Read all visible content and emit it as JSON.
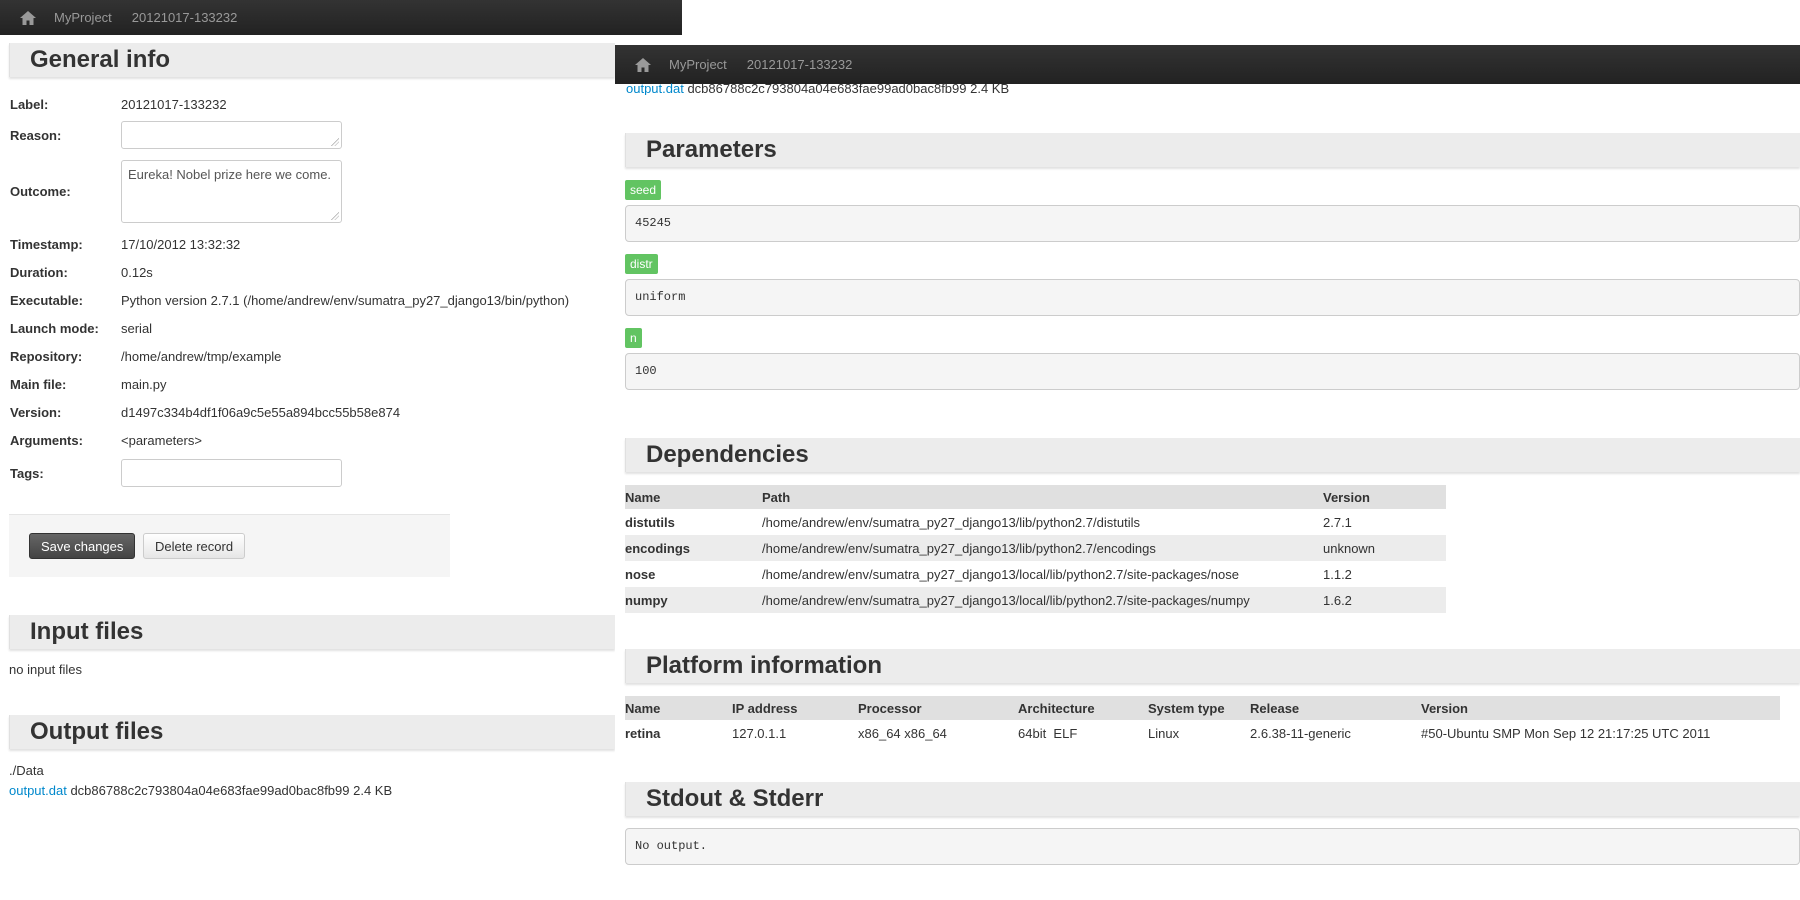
{
  "navbar": {
    "project": "MyProject",
    "record": "20121017-133232"
  },
  "general": {
    "title": "General info",
    "fields": {
      "label_key": "Label:",
      "label_val": "20121017-133232",
      "reason_key": "Reason:",
      "reason_val": "",
      "outcome_key": "Outcome:",
      "outcome_val": "Eureka! Nobel prize here we come.",
      "timestamp_key": "Timestamp:",
      "timestamp_val": "17/10/2012 13:32:32",
      "duration_key": "Duration:",
      "duration_val": "0.12s",
      "executable_key": "Executable:",
      "executable_val": "Python version 2.7.1 (/home/andrew/env/sumatra_py27_django13/bin/python)",
      "launch_key": "Launch mode:",
      "launch_val": "serial",
      "repo_key": "Repository:",
      "repo_val": "/home/andrew/tmp/example",
      "main_key": "Main file:",
      "main_val": "main.py",
      "version_key": "Version:",
      "version_val": "d1497c334b4df1f06a9c5e55a894bcc55b58e874",
      "args_key": "Arguments:",
      "args_val": "<parameters>",
      "tags_key": "Tags:",
      "tags_val": ""
    },
    "save_label": "Save changes",
    "delete_label": "Delete record"
  },
  "input_files": {
    "title": "Input files",
    "empty_text": "no input files"
  },
  "output_files": {
    "title": "Output files",
    "dir": "./Data",
    "file_name": "output.dat",
    "file_hash": "dcb86788c2c793804a04e683fae99ad0bac8fb99",
    "file_size": "2.4 KB"
  },
  "parameters": {
    "title": "Parameters",
    "items": [
      {
        "name": "seed",
        "value": "45245"
      },
      {
        "name": "distr",
        "value": "uniform"
      },
      {
        "name": "n",
        "value": "100"
      }
    ]
  },
  "dependencies": {
    "title": "Dependencies",
    "headers": [
      "Name",
      "Path",
      "Version"
    ],
    "rows": [
      [
        "distutils",
        "/home/andrew/env/sumatra_py27_django13/lib/python2.7/distutils",
        "2.7.1"
      ],
      [
        "encodings",
        "/home/andrew/env/sumatra_py27_django13/lib/python2.7/encodings",
        "unknown"
      ],
      [
        "nose",
        "/home/andrew/env/sumatra_py27_django13/local/lib/python2.7/site-packages/nose",
        "1.1.2"
      ],
      [
        "numpy",
        "/home/andrew/env/sumatra_py27_django13/local/lib/python2.7/site-packages/numpy",
        "1.6.2"
      ]
    ]
  },
  "platform": {
    "title": "Platform information",
    "headers": [
      "Name",
      "IP address",
      "Processor",
      "Architecture",
      "System type",
      "Release",
      "Version"
    ],
    "row": [
      "retina",
      "127.0.1.1",
      "x86_64 x86_64",
      "64bit  ELF",
      "Linux",
      "2.6.38-11-generic",
      "#50-Ubuntu SMP Mon Sep 12 21:17:25 UTC 2011"
    ]
  },
  "stdout": {
    "title": "Stdout & Stderr",
    "text": "No output."
  }
}
